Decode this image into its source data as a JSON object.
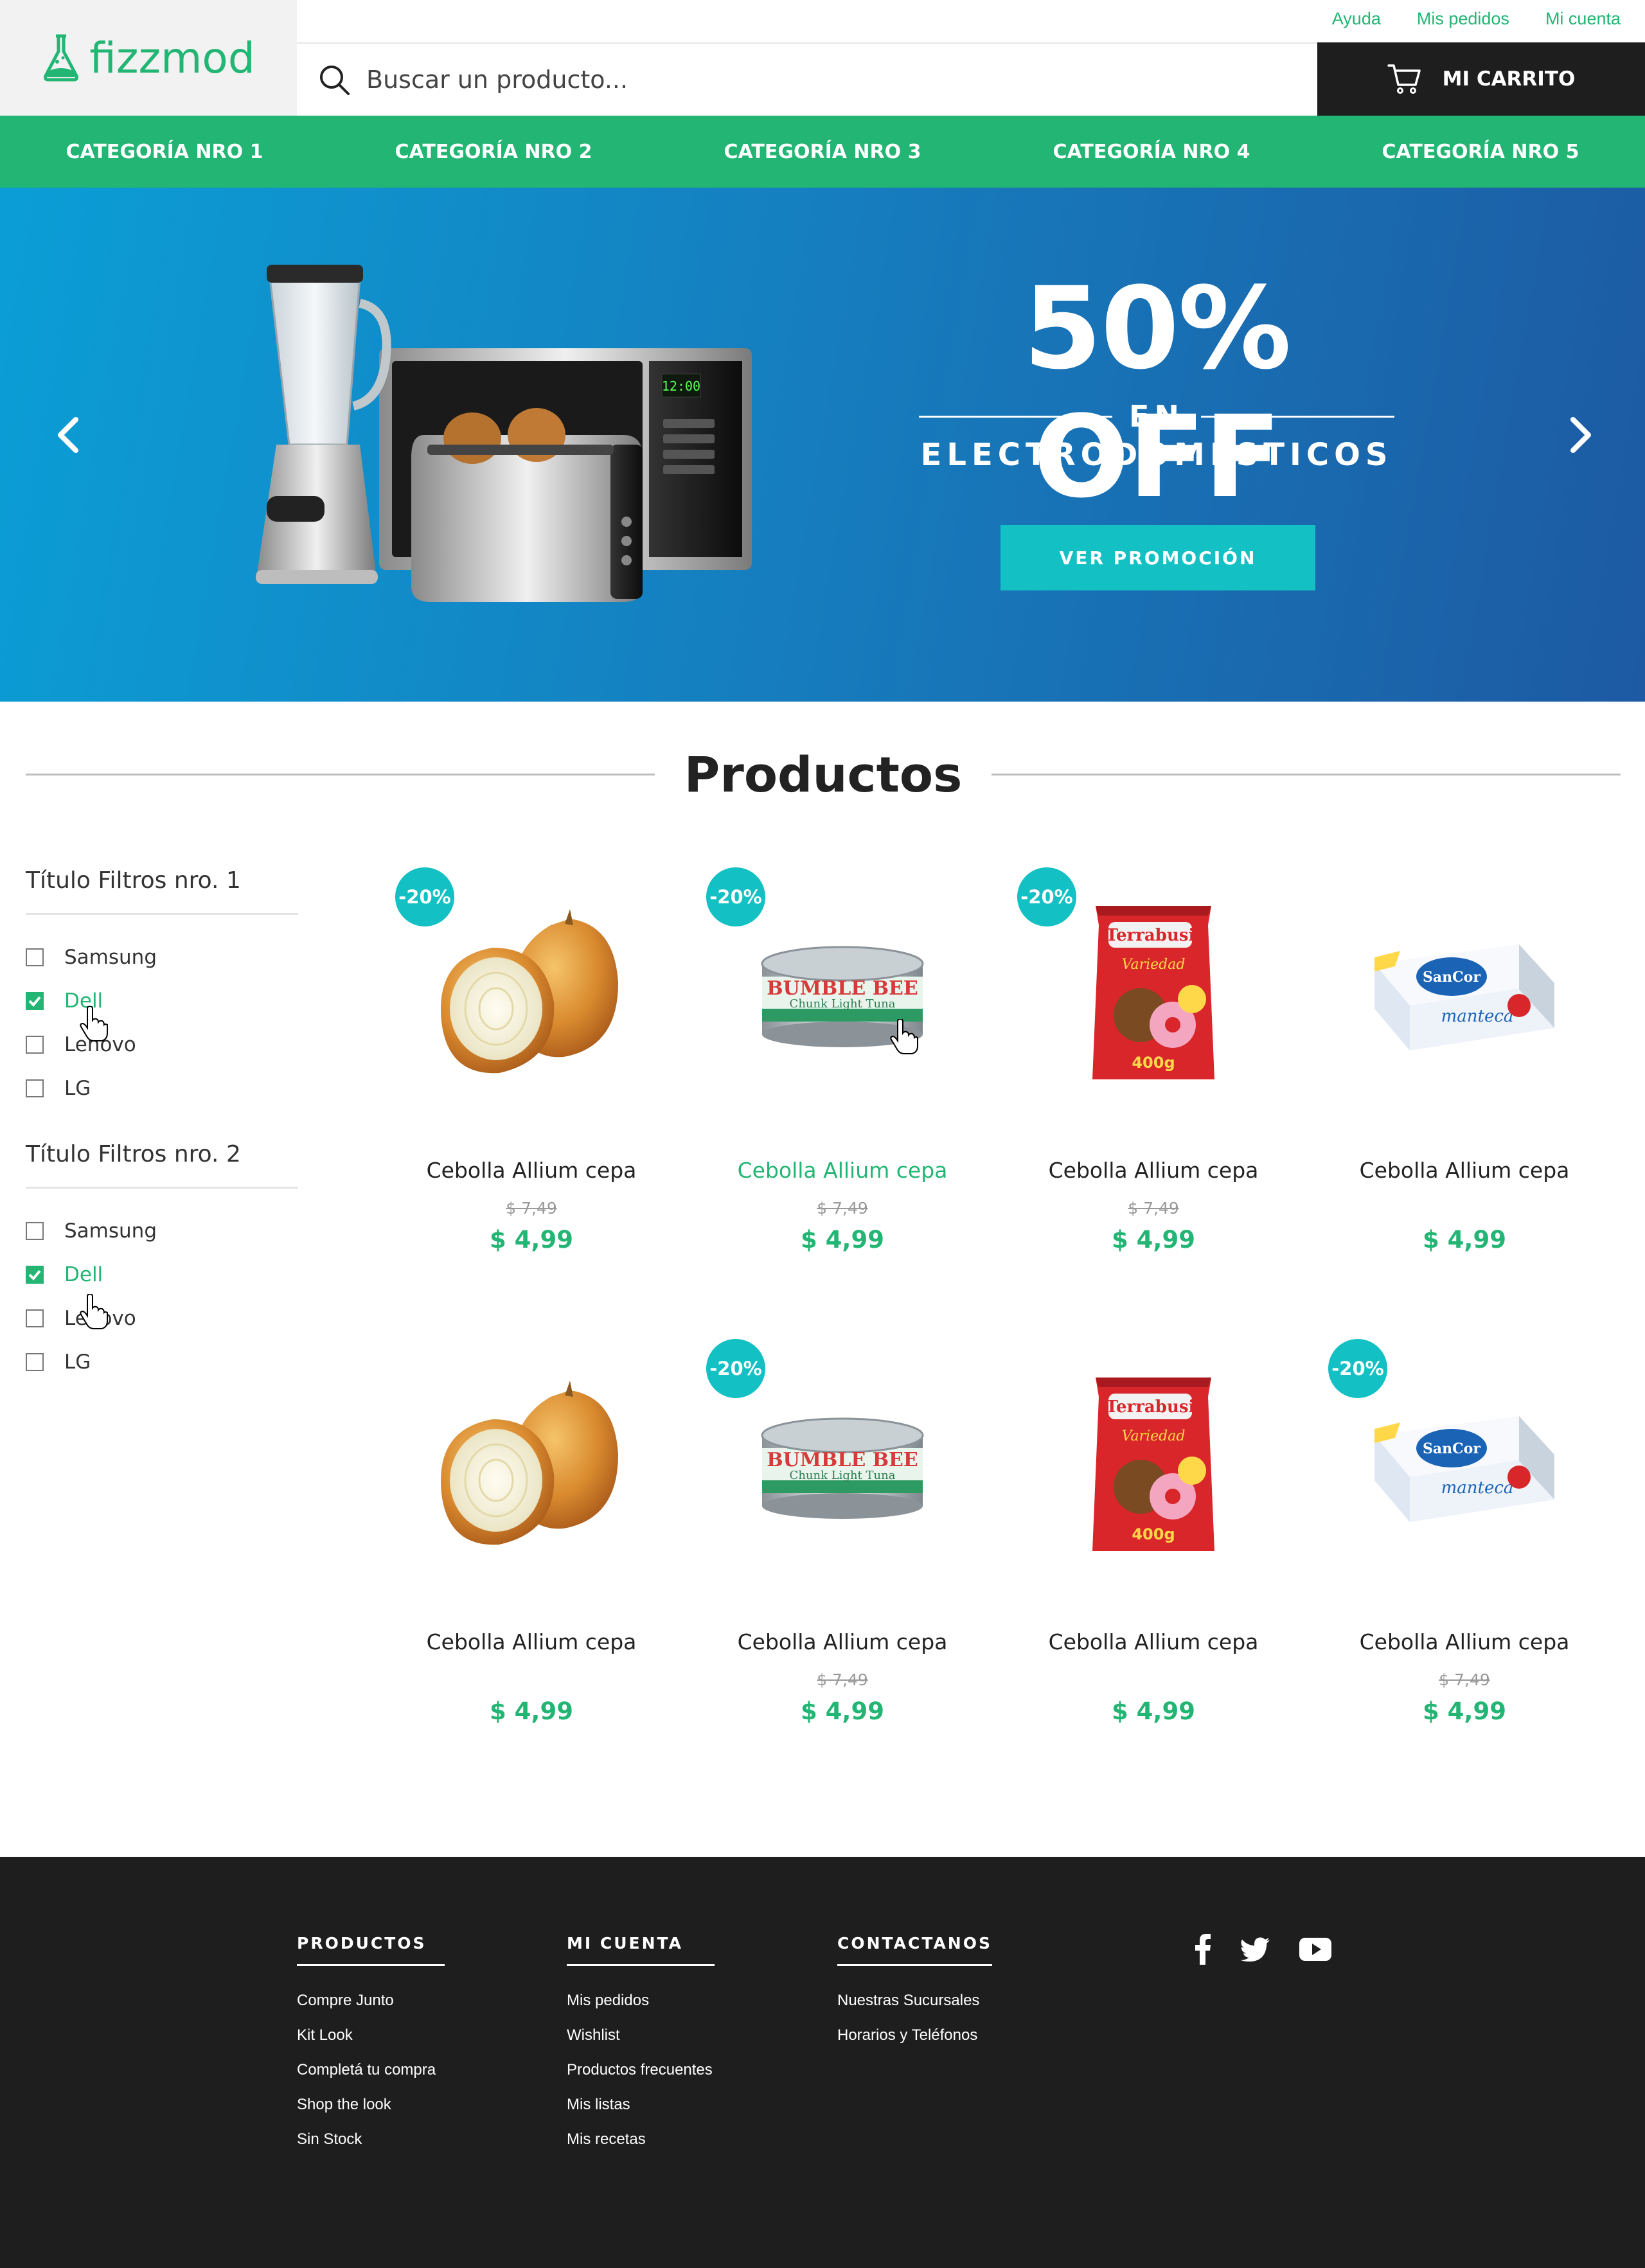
{
  "header": {
    "logo_text": "fizzmod",
    "links": [
      "Ayuda",
      "Mis pedidos",
      "Mi cuenta"
    ],
    "search_placeholder": "Buscar un producto...",
    "cart_label": "MI CARRITO"
  },
  "nav": {
    "categories": [
      "CATEGORÍA NRO 1",
      "CATEGORÍA NRO 2",
      "CATEGORÍA NRO 3",
      "CATEGORÍA NRO 4",
      "CATEGORÍA NRO 5"
    ]
  },
  "hero": {
    "title": "50% OFF",
    "en": "EN",
    "subtitle": "ELECTRODOMÉSTICOS",
    "button": "VER PROMOCIÓN"
  },
  "section_title": "Productos",
  "filters": [
    {
      "title": "Título Filtros nro. 1",
      "options": [
        {
          "label": "Samsung",
          "checked": false
        },
        {
          "label": "Dell",
          "checked": true
        },
        {
          "label": "Lenovo",
          "checked": false
        },
        {
          "label": "LG",
          "checked": false
        }
      ]
    },
    {
      "title": "Título Filtros nro. 2",
      "options": [
        {
          "label": "Samsung",
          "checked": false
        },
        {
          "label": "Dell",
          "checked": true
        },
        {
          "label": "Lenovo",
          "checked": false
        },
        {
          "label": "LG",
          "checked": false
        }
      ]
    }
  ],
  "products": [
    {
      "name": "Cebolla Allium cepa",
      "old_price": "$ 7,49",
      "price": "$ 4,99",
      "badge": "-20%",
      "image": "onion"
    },
    {
      "name": "Cebolla Allium cepa",
      "old_price": "$ 7,49",
      "price": "$ 4,99",
      "badge": "-20%",
      "image": "tuna-can",
      "hover": true
    },
    {
      "name": "Cebolla Allium cepa",
      "old_price": "$ 7,49",
      "price": "$ 4,99",
      "badge": "-20%",
      "image": "cookie-bag"
    },
    {
      "name": "Cebolla Allium cepa",
      "old_price": "",
      "price": "$ 4,99",
      "badge": "",
      "image": "butter-box"
    },
    {
      "name": "Cebolla Allium cepa",
      "old_price": "",
      "price": "$ 4,99",
      "badge": "",
      "image": "onion"
    },
    {
      "name": "Cebolla Allium cepa",
      "old_price": "$ 7,49",
      "price": "$ 4,99",
      "badge": "-20%",
      "image": "tuna-can"
    },
    {
      "name": "Cebolla Allium cepa",
      "old_price": "",
      "price": "$ 4,99",
      "badge": "",
      "image": "cookie-bag"
    },
    {
      "name": "Cebolla Allium cepa",
      "old_price": "$ 7,49",
      "price": "$ 4,99",
      "badge": "-20%",
      "image": "butter-box"
    }
  ],
  "footer": {
    "columns": [
      {
        "title": "PRODUCTOS",
        "links": [
          "Compre Junto",
          "Kit Look",
          "Completá tu compra",
          "Shop the look",
          "Sin Stock"
        ]
      },
      {
        "title": "MI CUENTA",
        "links": [
          "Mis pedidos",
          "Wishlist",
          "Productos frecuentes",
          "Mis listas",
          "Mis recetas"
        ]
      },
      {
        "title": "CONTACTANOS",
        "links": [
          "Nuestras Sucursales",
          "Horarios y Teléfonos"
        ]
      }
    ],
    "social": [
      "facebook-icon",
      "twitter-icon",
      "youtube-icon"
    ]
  },
  "colors": {
    "brand_green": "#22b573",
    "accent_teal": "#13c1c4",
    "dark": "#1e1e1e"
  }
}
